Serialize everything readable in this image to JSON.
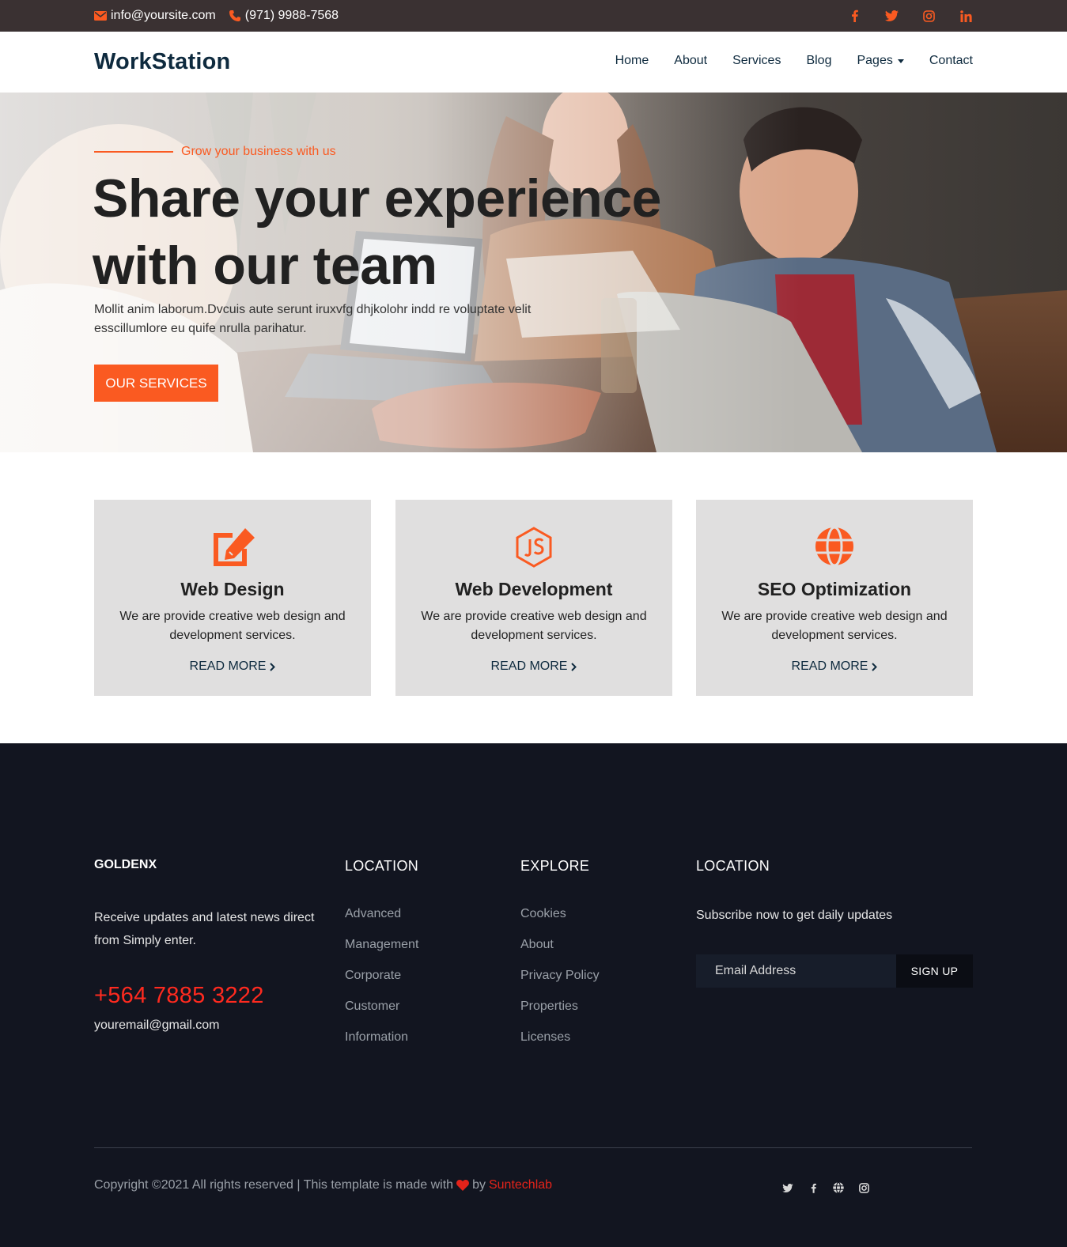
{
  "topbar": {
    "email": "info@yoursite.com",
    "phone": "(971) 9988-7568",
    "social": [
      "facebook-icon",
      "twitter-icon",
      "instagram-icon",
      "linkedin-icon"
    ]
  },
  "nav": {
    "brand": "WorkStation",
    "items": [
      {
        "label": "Home"
      },
      {
        "label": "About"
      },
      {
        "label": "Services"
      },
      {
        "label": "Blog"
      },
      {
        "label": "Pages"
      },
      {
        "label": "Contact"
      }
    ]
  },
  "hero": {
    "kicker": "Grow your business with us",
    "title_line1": "Share your experience",
    "title_line2": "with our team",
    "description": "Mollit anim laborum.Dvcuis aute serunt iruxvfg dhjkolohr indd re voluptate velit esscillumlore eu quife nrulla parihatur.",
    "button": "OUR SERVICES"
  },
  "features": [
    {
      "icon": "edit-icon",
      "title": "Web Design",
      "description": "We are provide creative web design and development services.",
      "link": "READ MORE"
    },
    {
      "icon": "nodejs-icon",
      "title": "Web Development",
      "description": "We are provide creative web design and development services.",
      "link": "READ MORE"
    },
    {
      "icon": "globe-icon",
      "title": "SEO Optimization",
      "description": "We are provide creative web design and development services.",
      "link": "READ MORE"
    }
  ],
  "footer": {
    "col1": {
      "heading": "GOLDENX",
      "text": "Receive updates and latest news direct from Simply enter.",
      "phone": "+564 7885 3222",
      "email": "youremail@gmail.com"
    },
    "col2": {
      "heading": "LOCATION",
      "links": [
        "Advanced",
        "Management",
        "Corporate",
        "Customer",
        "Information"
      ]
    },
    "col3": {
      "heading": "EXPLORE",
      "links": [
        "Cookies",
        "About",
        "Privacy Policy",
        "Properties",
        "Licenses"
      ]
    },
    "col4": {
      "heading": "LOCATION",
      "subtitle": "Subscribe now to get daily updates",
      "placeholder": "Email Address",
      "button": "SIGN UP"
    },
    "copyright_prefix": "Copyright ©2021 All rights reserved | This template is made with",
    "copyright_by": "by",
    "copyright_brand": "Suntechlab",
    "social": [
      "twitter-icon",
      "facebook-icon",
      "globe-icon",
      "instagram-icon"
    ]
  },
  "colors": {
    "accent": "#fa5a21",
    "topbar": "#3a3132",
    "footer_bg": "#121520",
    "card_bg": "#e0dfdf",
    "brand_text": "#0e2a3e",
    "phone_red": "#ff2a1f"
  }
}
